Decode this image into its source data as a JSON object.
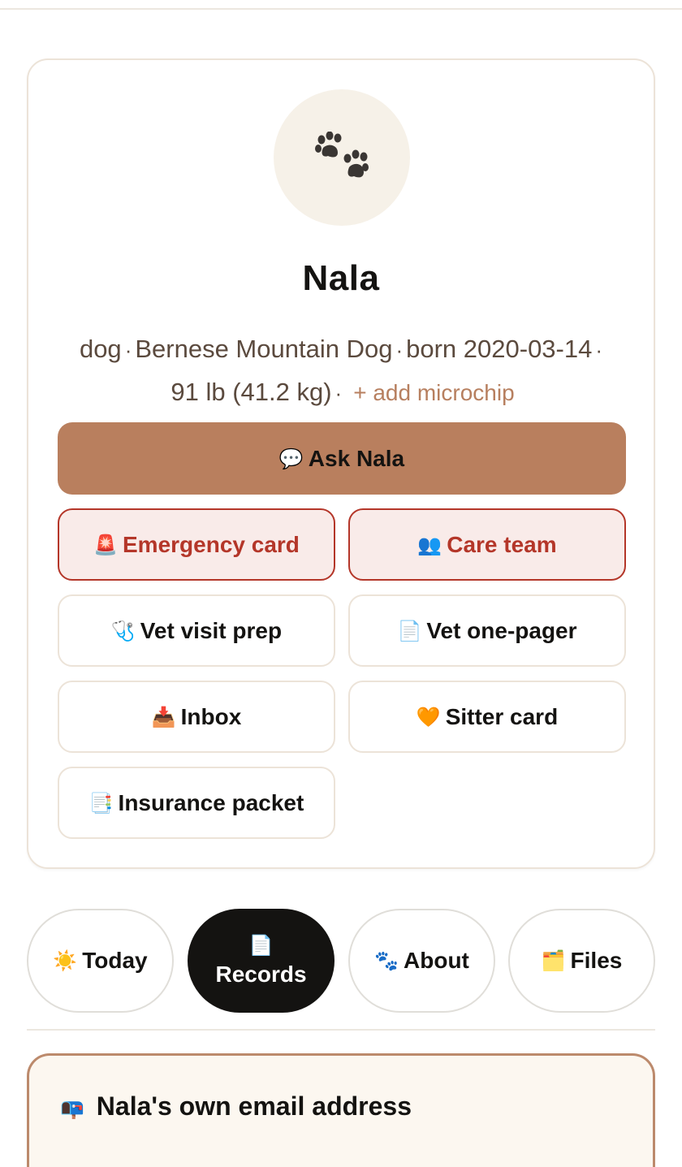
{
  "pet": {
    "avatar_icon": "paw-prints-icon",
    "name": "Nala",
    "species": "dog",
    "breed": "Bernese Mountain Dog",
    "born": "born 2020-03-14",
    "weight": "91 lb (41.2 kg)",
    "sep": "·",
    "add_microchip": "+ add microchip"
  },
  "ask": {
    "icon": "💬",
    "label": "Ask Nala"
  },
  "actions": {
    "emergency": {
      "icon": "🚨",
      "label": "Emergency card"
    },
    "care_team": {
      "icon": "👥",
      "label": "Care team"
    },
    "vet_visit": {
      "icon": "🩺",
      "label": "Vet visit prep"
    },
    "vet_onepager": {
      "icon": "📄",
      "label": "Vet one-pager"
    },
    "inbox": {
      "icon": "📥",
      "label": "Inbox"
    },
    "sitter": {
      "icon": "🧡",
      "label": "Sitter card"
    },
    "insurance": {
      "icon": "📑",
      "label": "Insurance packet"
    }
  },
  "tabs": [
    {
      "icon": "☀️",
      "label": "Today"
    },
    {
      "icon": "📄",
      "label": "Records"
    },
    {
      "icon": "🐾",
      "label": "About"
    },
    {
      "icon": "🗂️",
      "label": "Files"
    }
  ],
  "active_tab": "Records",
  "email_section": {
    "icon": "📭",
    "title": "Nala's own email address"
  },
  "colors": {
    "accent": "#b97f5e",
    "danger": "#b43629",
    "danger_bg": "#f9ebe9",
    "active_tab": "#141311"
  }
}
